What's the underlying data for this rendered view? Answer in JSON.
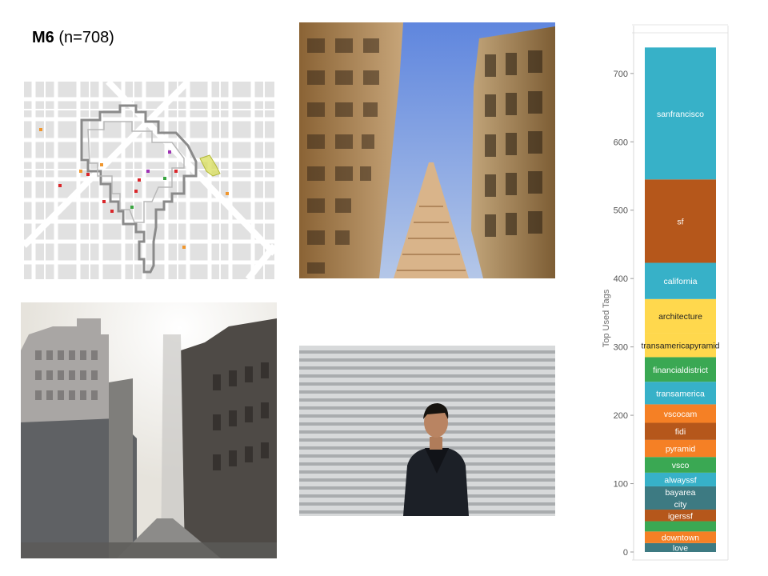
{
  "header": {
    "title_bold": "M6",
    "title_rest": " (n=708)"
  },
  "map": {
    "markers": [
      {
        "color": "#f0962d"
      },
      {
        "color": "#f0962d"
      },
      {
        "color": "#f0962d"
      },
      {
        "color": "#f0962d"
      },
      {
        "color": "#f0962d"
      },
      {
        "color": "#d9262a"
      },
      {
        "color": "#d9262a"
      },
      {
        "color": "#d9262a"
      },
      {
        "color": "#d9262a"
      },
      {
        "color": "#d9262a"
      },
      {
        "color": "#d9262a"
      },
      {
        "color": "#d9262a"
      },
      {
        "color": "#9e32b4"
      },
      {
        "color": "#9e32b4"
      },
      {
        "color": "#3aa541"
      },
      {
        "color": "#3aa541"
      }
    ],
    "highlight_color": "#d8de5a"
  },
  "photos": [
    {
      "subject": "skyscrapers-pyramid-upward",
      "sky": "#7da4e8"
    },
    {
      "subject": "downtown-street-buildings",
      "sky": "#f4f2ee"
    },
    {
      "subject": "man-coat-metal-shutter",
      "wall": "#cfd1d2"
    }
  ],
  "chart_data": {
    "type": "bar",
    "stacked": true,
    "title": "",
    "xlabel": "",
    "ylabel": "Top Used Tags",
    "ylim": [
      0,
      770
    ],
    "yticks": [
      0,
      100,
      200,
      300,
      400,
      500,
      600,
      700
    ],
    "grid": false,
    "legend": "none",
    "segments": [
      {
        "label": "love",
        "value": 13,
        "color": "#3d7a82"
      },
      {
        "label": "downtown",
        "value": 17,
        "color": "#f58025"
      },
      {
        "label": "",
        "value": 15,
        "color": "#3aa853"
      },
      {
        "label": "igerssf",
        "value": 17,
        "color": "#b5571b"
      },
      {
        "label": "city",
        "value": 17,
        "color": "#3d7a82"
      },
      {
        "label": "bayarea",
        "value": 17,
        "color": "#3d7a82"
      },
      {
        "label": "alwayssf",
        "value": 20,
        "color": "#37b1c8"
      },
      {
        "label": "vsco",
        "value": 23,
        "color": "#3aa853"
      },
      {
        "label": "pyramid",
        "value": 25,
        "color": "#f58025"
      },
      {
        "label": "fidi",
        "value": 25,
        "color": "#b5571b"
      },
      {
        "label": "vscocam",
        "value": 27,
        "color": "#f58025"
      },
      {
        "label": "transamerica",
        "value": 33,
        "color": "#37b1c8"
      },
      {
        "label": "financialdistrict",
        "value": 36,
        "color": "#3aa853"
      },
      {
        "label": "transamericapyramid",
        "value": 35,
        "color": "#ffd84d"
      },
      {
        "label": "architecture",
        "value": 50,
        "color": "#ffd84d"
      },
      {
        "label": "california",
        "value": 53,
        "color": "#37b1c8"
      },
      {
        "label": "sf",
        "value": 122,
        "color": "#b5571b"
      },
      {
        "label": "sanfrancisco",
        "value": 193,
        "color": "#37b1c8"
      }
    ]
  }
}
